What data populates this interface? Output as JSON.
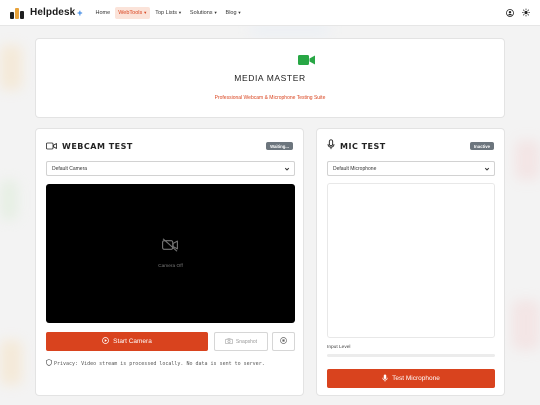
{
  "nav": {
    "brand": "Helpdesk",
    "brand_plus": "+",
    "items": [
      {
        "label": "Home",
        "dropdown": false,
        "active": false
      },
      {
        "label": "WebTools",
        "dropdown": true,
        "active": true
      },
      {
        "label": "Top Lists",
        "dropdown": true,
        "active": false
      },
      {
        "label": "Solutions",
        "dropdown": true,
        "active": false
      },
      {
        "label": "Blog",
        "dropdown": true,
        "active": false
      }
    ],
    "right_icons": [
      "user-circle-icon",
      "sun-icon"
    ]
  },
  "hero": {
    "icon": "video-camera-icon",
    "title": "MEDIA MASTER",
    "subtitle": "Professional Webcam & Microphone Testing Suite"
  },
  "webcam": {
    "icon": "camera-outline-icon",
    "title": "WEBCAM TEST",
    "status": "Waiting...",
    "select_value": "Default Camera",
    "placeholder_icon": "camera-off-icon",
    "placeholder_label": "Camera Off",
    "start_label": "Start Camera",
    "snapshot_label": "Snapshot",
    "privacy": "Privacy: Video stream is processed locally. No data is sent to server."
  },
  "mic": {
    "icon": "microphone-icon",
    "title": "MIC TEST",
    "status": "Inactive",
    "select_value": "Default Microphone",
    "level_label": "Input Level",
    "level": 0,
    "test_label": "Test Microphone"
  },
  "colors": {
    "accent": "#d9431e",
    "hero_icon": "#28a745",
    "badge": "#6c757d"
  }
}
